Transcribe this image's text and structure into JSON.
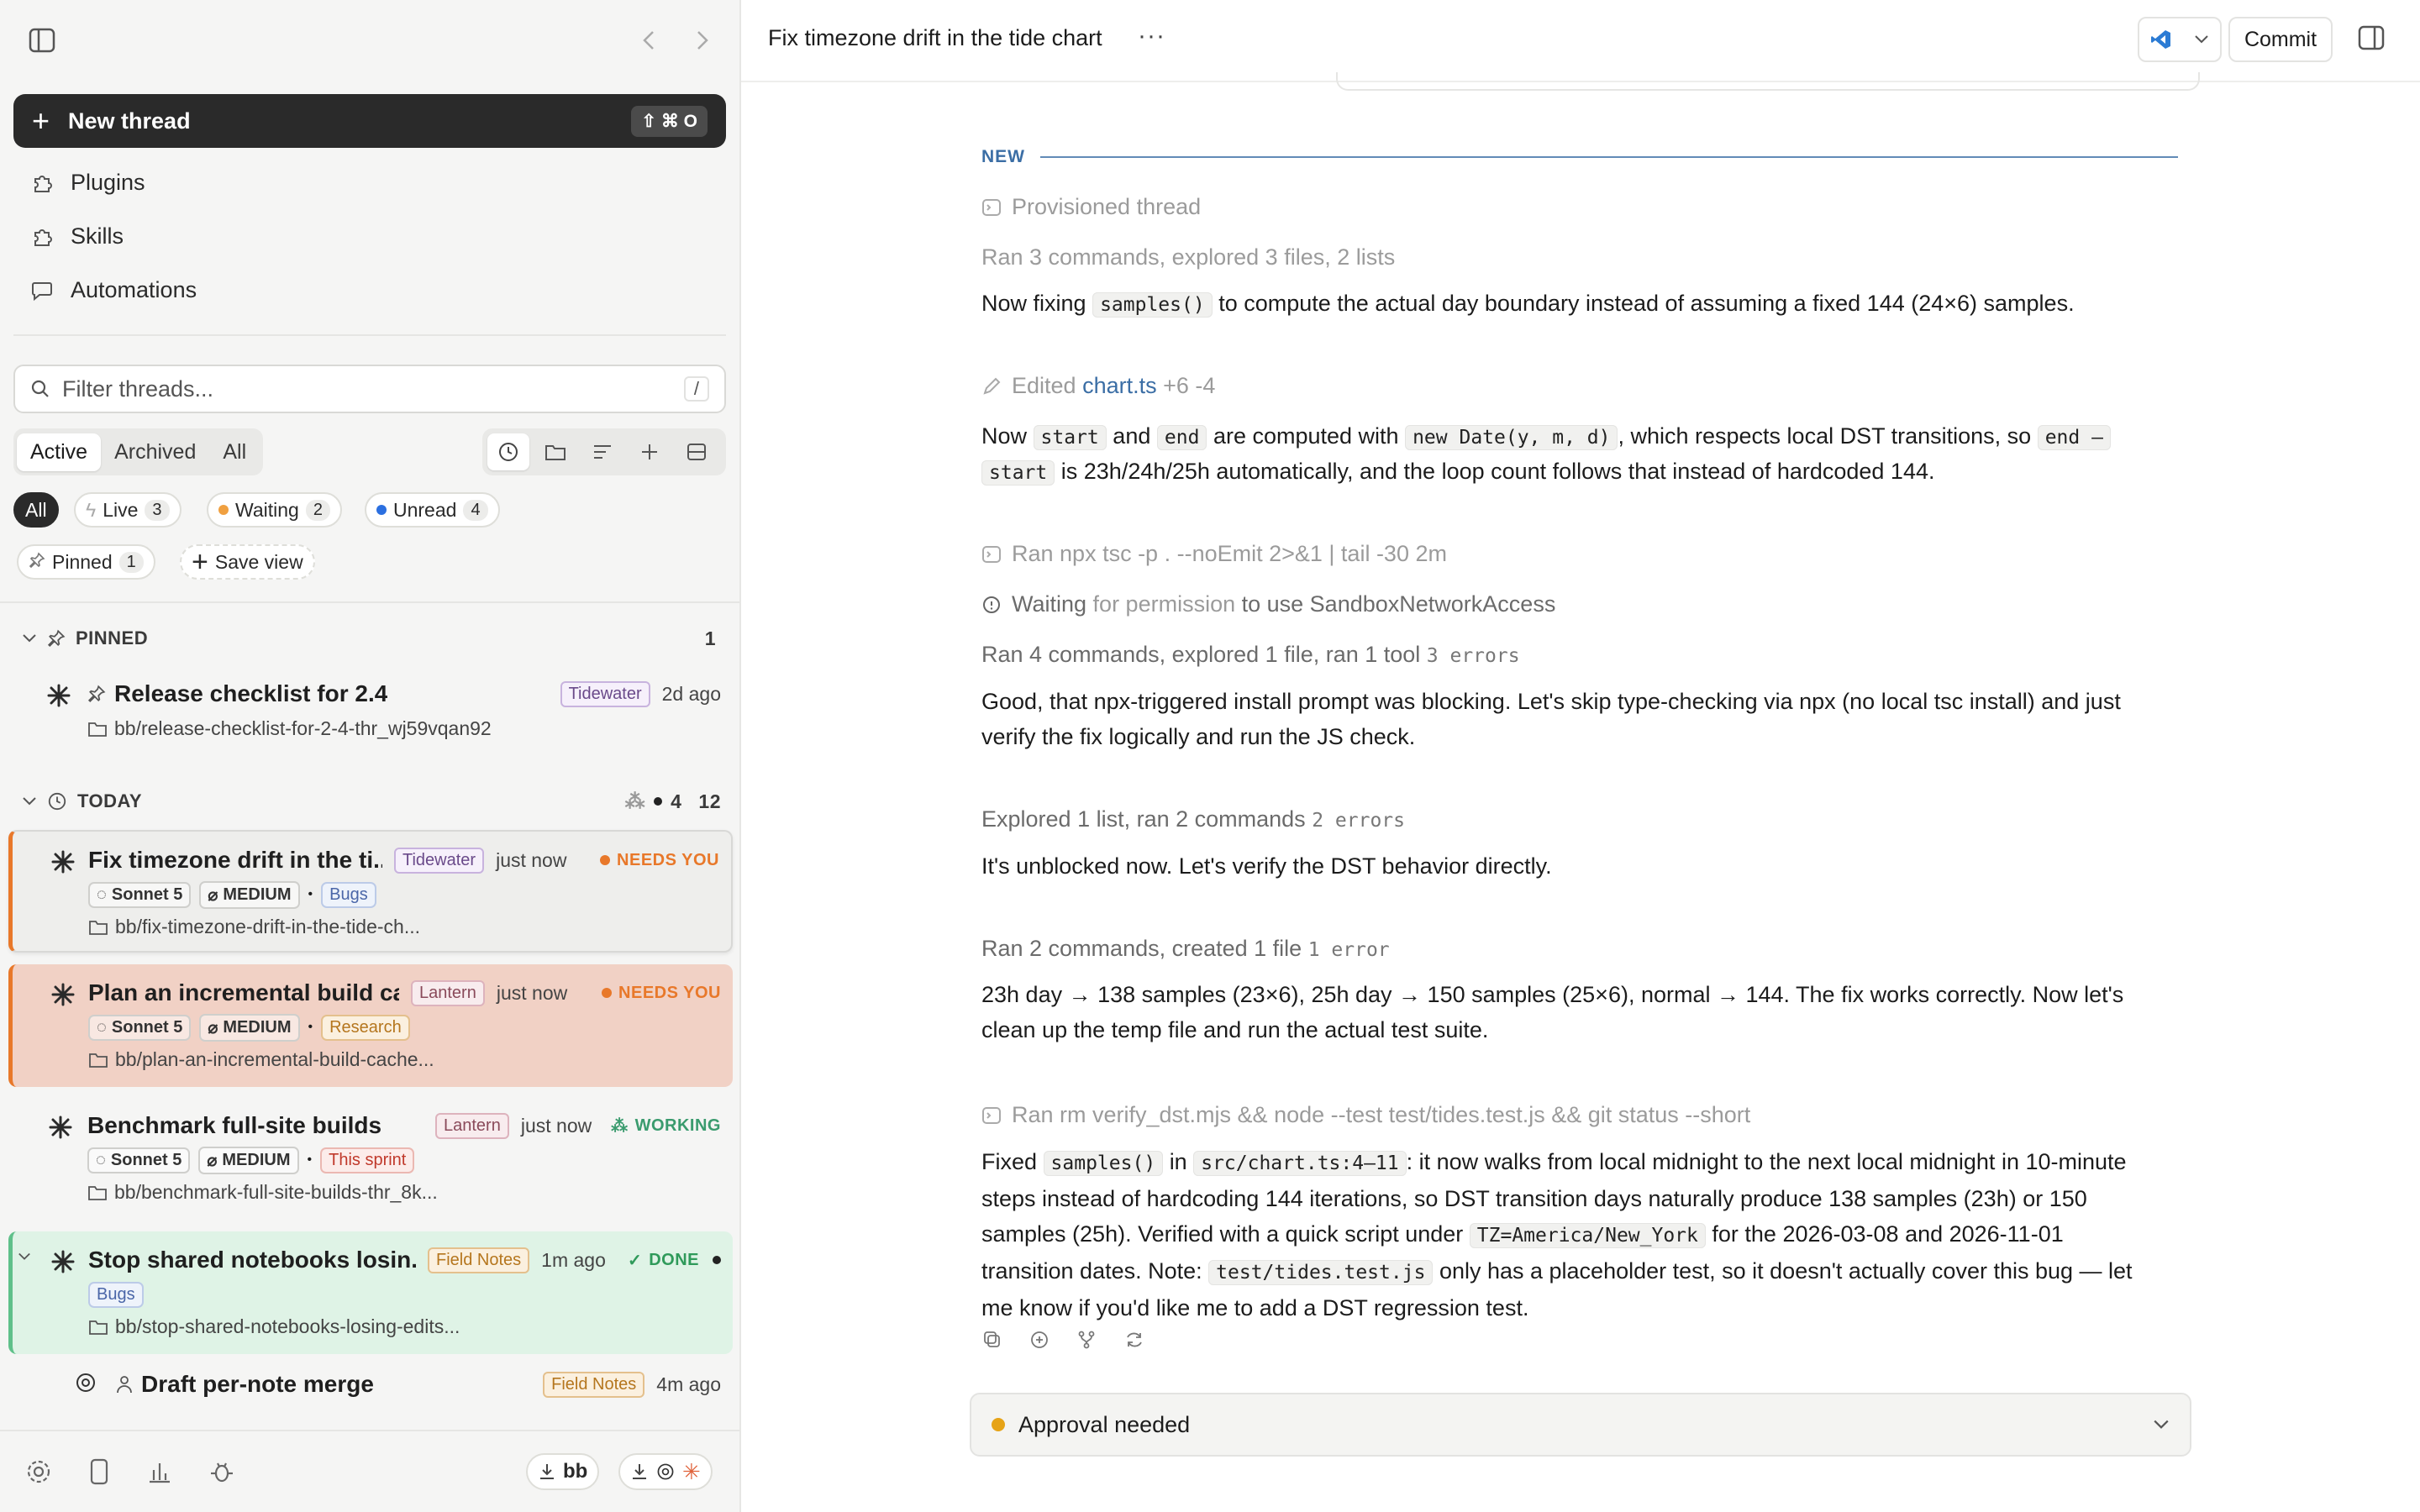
{
  "sidebar": {
    "new_thread_label": "New thread",
    "new_thread_shortcut": "⇧ ⌘ O",
    "nav": [
      "Plugins",
      "Skills",
      "Automations"
    ],
    "filter_placeholder": "Filter threads...",
    "filter_shortcut": "/",
    "tabs": [
      "Active",
      "Archived",
      "All"
    ],
    "chips": {
      "all": "All",
      "live": "Live",
      "live_count": "3",
      "waiting": "Waiting",
      "waiting_count": "2",
      "unread": "Unread",
      "unread_count": "4",
      "pinned": "Pinned",
      "pinned_count": "1",
      "save_view": "Save view"
    },
    "sections": {
      "pinned": "PINNED",
      "pinned_count": "1",
      "today": "TODAY",
      "today_dot_count": "4",
      "today_count": "12"
    },
    "threads": [
      {
        "title": "Release checklist for 2.4",
        "tag": "Tidewater",
        "time": "2d ago",
        "path": "bb/release-checklist-for-2-4-thr_wj59vqan92"
      },
      {
        "title": "Fix timezone drift in the ti...",
        "tag": "Tidewater",
        "time": "just now",
        "status": "NEEDS YOU",
        "model": "Sonnet 5",
        "effort": "MEDIUM",
        "label": "Bugs",
        "path": "bb/fix-timezone-drift-in-the-tide-ch..."
      },
      {
        "title": "Plan an incremental build ca...",
        "tag": "Lantern",
        "time": "just now",
        "status": "NEEDS YOU",
        "model": "Sonnet 5",
        "effort": "MEDIUM",
        "label": "Research",
        "path": "bb/plan-an-incremental-build-cache..."
      },
      {
        "title": "Benchmark full-site builds",
        "tag": "Lantern",
        "time": "just now",
        "status": "WORKING",
        "model": "Sonnet 5",
        "effort": "MEDIUM",
        "label": "This sprint",
        "path": "bb/benchmark-full-site-builds-thr_8k..."
      },
      {
        "title": "Stop shared notebooks losin...",
        "tag": "Field Notes",
        "time": "1m ago",
        "status": "DONE",
        "label": "Bugs",
        "path": "bb/stop-shared-notebooks-losing-edits..."
      },
      {
        "title": "Draft per-note merge",
        "tag": "Field Notes",
        "time": "4m ago"
      }
    ],
    "footer": {
      "bb_label": "bb"
    }
  },
  "topbar": {
    "title": "Fix timezone drift in the tide chart",
    "commit_label": "Commit"
  },
  "content": {
    "new_label": "NEW",
    "provisioned": "Provisioned thread",
    "ran1": "Ran 3 commands, explored 3 files, 2 lists",
    "msg1_a": "Now fixing",
    "msg1_code": "samples()",
    "msg1_b": "to compute the actual day boundary instead of assuming a fixed 144 (24×6) samples.",
    "edited_prefix": "Edited",
    "edited_file": "chart.ts",
    "edited_diff": "+6 -4",
    "msg2_a": "Now",
    "msg2_c1": "start",
    "msg2_b": "and",
    "msg2_c2": "end",
    "msg2_c": "are computed with",
    "msg2_c3": "new Date(y, m, d)",
    "msg2_d": ", which respects local DST transitions, so",
    "msg2_c4": "end –",
    "msg2_c5": "start",
    "msg2_e": "is 23h/24h/25h automatically, and the loop count follows that instead of hardcoded 144.",
    "ran_tsc": "Ran npx tsc -p . --noEmit 2>&1 | tail -30 2m",
    "wait_a": "Waiting",
    "wait_b": "for permission",
    "wait_c": "to use SandboxNetworkAccess",
    "ran2": "Ran 4 commands, explored 1 file, ran 1 tool",
    "ran2_err": "3 errors",
    "msg3_l1": "Good, that npx-triggered install prompt was blocking. Let's skip type-checking via npx (no local tsc install) and just",
    "msg3_l2": "verify the fix logically and run the JS check.",
    "ran3": "Explored 1 list, ran 2 commands",
    "ran3_err": "2 errors",
    "msg4": "It's unblocked now. Let's verify the DST behavior directly.",
    "ran4": "Ran 2 commands, created 1 file",
    "ran4_err": "1 error",
    "msg5_l1": "23h day → 138 samples (23×6), 25h day → 150 samples (25×6), normal → 144. The fix works correctly. Now let's",
    "msg5_l2": "clean up the temp file and run the actual test suite.",
    "ran_rm": "Ran rm verify_dst.mjs && node --test test/tides.test.js && git status --short",
    "msg6_a": "Fixed",
    "msg6_c1": "samples()",
    "msg6_b": "in",
    "msg6_c2": "src/chart.ts:4–11",
    "msg6_c": ": it now walks from local midnight to the next local midnight in 10-minute",
    "msg6_l2": "steps instead of hardcoding 144 iterations, so DST transition days naturally produce 138 samples (23h) or 150",
    "msg6_l3a": "samples (25h). Verified with a quick script under",
    "msg6_c3": "TZ=America/New_York",
    "msg6_l3b": "for the 2026-03-08 and 2026-11-01",
    "msg6_l4a": "transition dates. Note:",
    "msg6_c4": "test/tides.test.js",
    "msg6_l4b": "only has a placeholder test, so it doesn't actually cover this bug — let",
    "msg6_l5": "me know if you'd like me to add a DST regression test.",
    "approval": "Approval needed"
  },
  "colors": {
    "accent_blue": "#3b6ea5",
    "needs_you": "#e8782a",
    "working": "#3a9b6e",
    "done": "#2f9a5a",
    "waiting_dot": "#f0a040",
    "unread_dot": "#2b6fe0",
    "approval_dot": "#e6a317"
  }
}
